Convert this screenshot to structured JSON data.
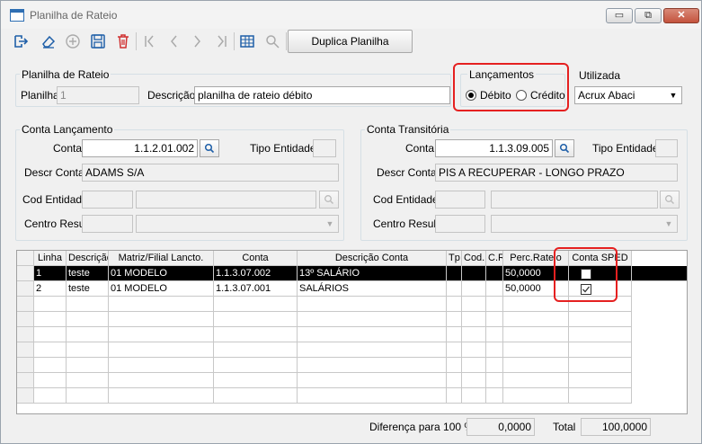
{
  "window": {
    "title": "Planilha de Rateio",
    "minimize": "▭",
    "maximize": "⧉",
    "close": "✕"
  },
  "toolbar": {
    "duplicate_label": "Duplica Planilha"
  },
  "planilha": {
    "group_label": "Planilha de Rateio",
    "planilha_label": "Planilha",
    "planilha_value": "1",
    "descricao_label": "Descrição",
    "descricao_value": "planilha de rateio débito"
  },
  "lancamentos": {
    "label": "Lançamentos",
    "debito": "Débito",
    "credito": "Crédito",
    "selected": "Débito"
  },
  "utilizada": {
    "label": "Utilizada",
    "value": "Acrux Abaci"
  },
  "conta_lancamento": {
    "group_label": "Conta Lançamento",
    "conta_label": "Conta",
    "conta_value": "1.1.2.01.002",
    "tipo_label": "Tipo Entidade",
    "tipo_value": "",
    "descr_label": "Descr Conta",
    "descr_value": "ADAMS S/A",
    "cod_label": "Cod Entidade",
    "centro_label": "Centro Result"
  },
  "conta_transitoria": {
    "group_label": "Conta Transitória",
    "conta_label": "Conta",
    "conta_value": "1.1.3.09.005",
    "tipo_label": "Tipo Entidade",
    "tipo_value": "",
    "descr_label": "Descr Conta",
    "descr_value": "PIS A RECUPERAR - LONGO PRAZO",
    "cod_label": "Cod Entidade",
    "centro_label": "Centro Result"
  },
  "grid": {
    "headers": [
      "Linha",
      "Descrição",
      "Matriz/Filial Lancto.",
      "Conta",
      "Descrição Conta",
      "Tp",
      "Cod.",
      "C.R",
      "Perc.Rateio",
      "Conta SPED"
    ],
    "rows": [
      {
        "linha": "1",
        "descricao": "teste",
        "matriz": "01 MODELO",
        "conta": "1.1.3.07.002",
        "descricao_conta": "13º SALÁRIO",
        "perc": "50,0000",
        "sped": false
      },
      {
        "linha": "2",
        "descricao": "teste",
        "matriz": "01 MODELO",
        "conta": "1.1.3.07.001",
        "descricao_conta": "SALÁRIOS",
        "perc": "50,0000",
        "sped": true
      }
    ]
  },
  "footer": {
    "diff_label": "Diferença para 100 %",
    "diff_value": "0,0000",
    "total_label": "Total",
    "total_value": "100,0000"
  },
  "colors": {
    "highlight": "#e52020",
    "selected_row": "#000000"
  }
}
